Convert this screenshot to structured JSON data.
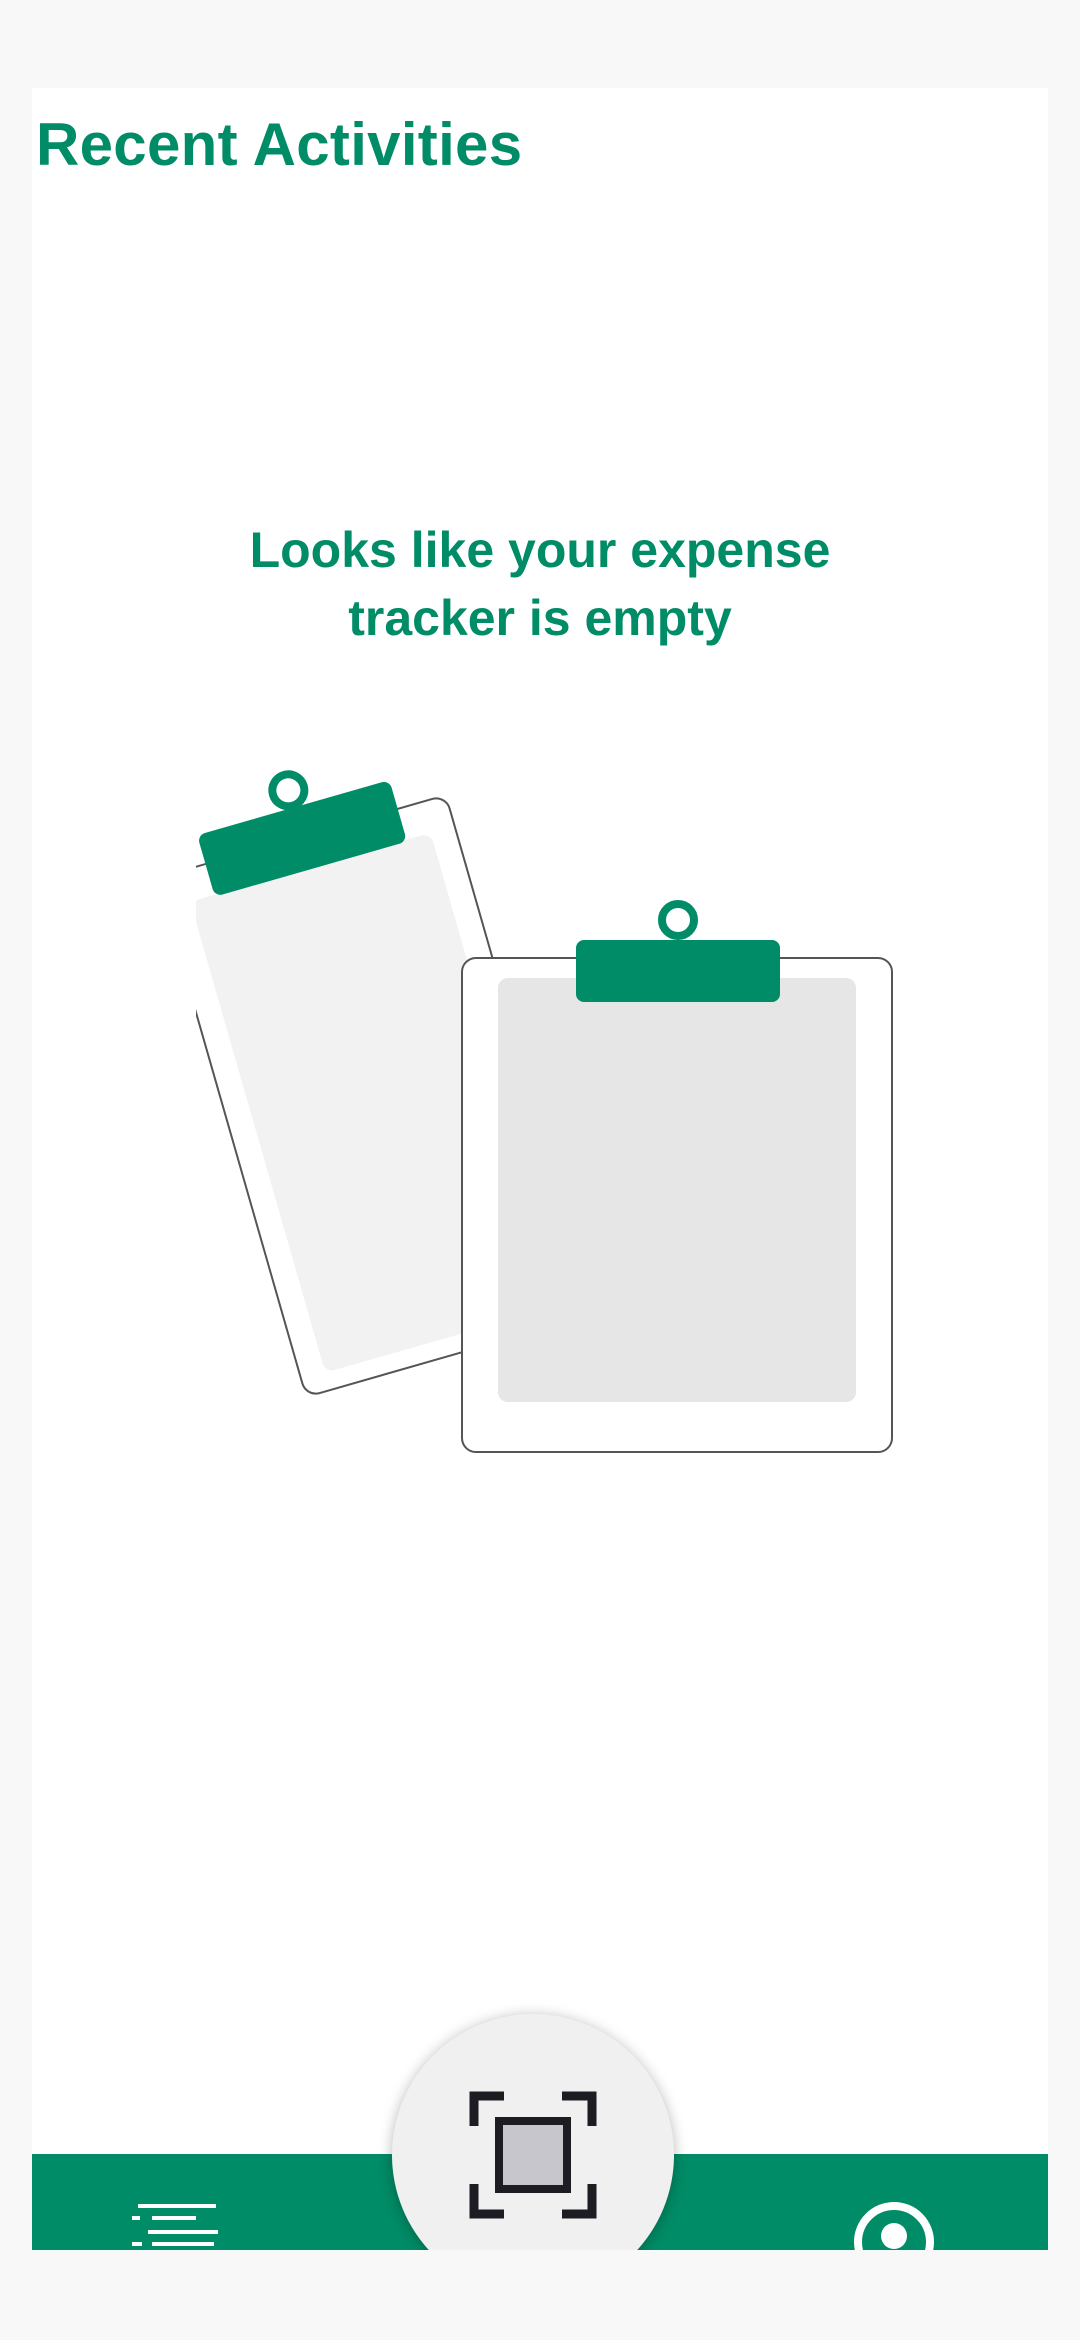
{
  "header": {
    "title": "Recent Activities"
  },
  "empty_state": {
    "message": "Looks like your expense tracker is empty",
    "illustration_icon": "clipboard-icon"
  },
  "bottom_nav": {
    "left_icon": "list-icon",
    "center_icon": "scan-icon",
    "right_icon": "profile-icon"
  },
  "colors": {
    "accent": "#008c66",
    "background": "#f8f8f8",
    "surface": "#ffffff"
  }
}
